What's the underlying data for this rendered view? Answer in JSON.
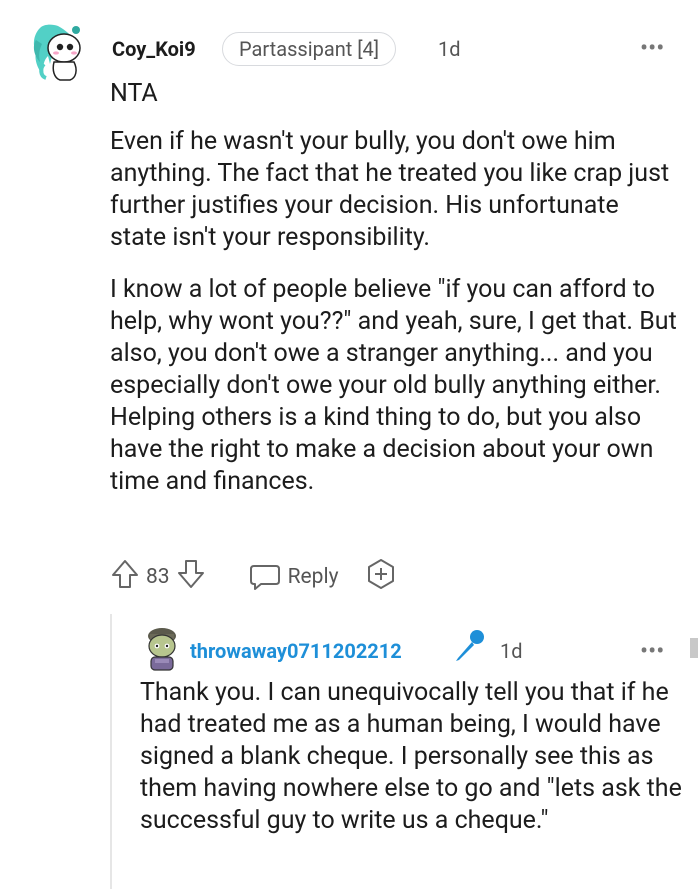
{
  "comment": {
    "username": "Coy_Koi9",
    "flair": "Partassipant [4]",
    "age": "1d",
    "more": "•••",
    "paragraphs": [
      "NTA",
      "Even if he wasn't your bully, you don't owe him anything. The fact that he treated you like crap just further justifies your decision. His unfortunate state isn't your responsibility.",
      "I know a lot of people believe \"if you can afford to help, why wont you??\" and yeah, sure, I get that. But also, you don't owe a stranger anything... and you especially don't owe your old bully anything either. Helping others is a kind thing to do, but you also have the right to make a decision about your own time and finances."
    ],
    "score": "83",
    "reply_label": "Reply"
  },
  "reply": {
    "username": "throwaway0711202212",
    "age": "1d",
    "more": "•••",
    "text": "Thank you. I can unequivocally tell you that if he had treated me as a human being, I would have signed a blank cheque. I personally see this as them having nowhere else to go and \"lets ask the successful guy to write us a cheque.\""
  },
  "colors": {
    "op_username": "#1e8fd8",
    "text": "#1c1c1c",
    "meta": "#555555"
  },
  "icons": {
    "upvote": "arrow-up-icon",
    "downvote": "arrow-down-icon",
    "reply": "speech-bubble-icon",
    "award": "plus-award-icon",
    "mic": "microphone-icon"
  }
}
